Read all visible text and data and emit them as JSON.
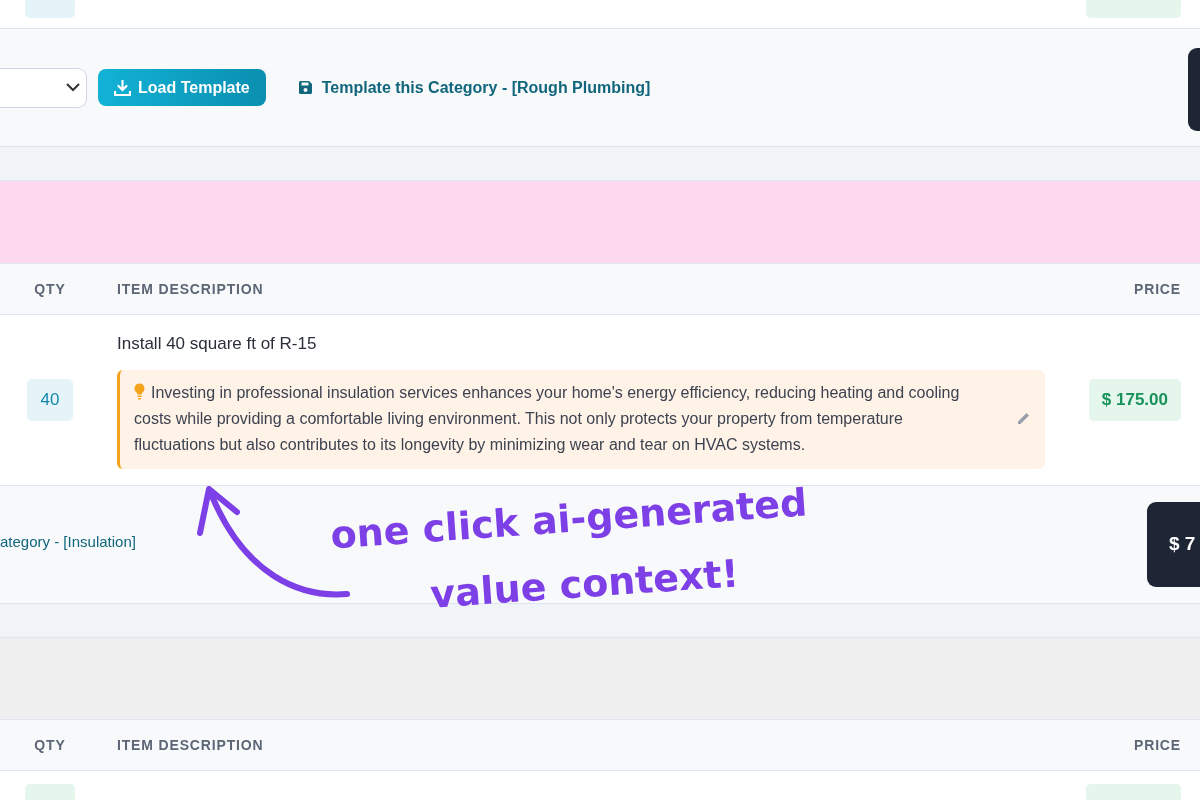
{
  "category_toolbar": {
    "load_button": "Load Template",
    "save_link": "Template this Category - [Rough Plumbing]"
  },
  "items_table": {
    "columns": [
      "QTY",
      "ITEM DESCRIPTION",
      "PRICE"
    ],
    "rows": [
      {
        "qty": "40",
        "description": "Install 40 square ft of R-15",
        "value_context": "Investing in professional insulation services enhances your home's energy efficiency, reducing heating and cooling costs while providing a comfortable living environment. This not only protects your property from temperature fluctuations but also contributes to its longevity by minimizing wear and tear on HVAC systems.",
        "price": "$ 175.00"
      }
    ]
  },
  "insulation_toolbar": {
    "save_link": "ategory - [Insulation]",
    "total": "$ 7"
  },
  "next_table": {
    "columns": [
      "QTY",
      "ITEM DESCRIPTION",
      "PRICE"
    ]
  },
  "annotation": [
    "one click ai-generated",
    "value context!"
  ]
}
